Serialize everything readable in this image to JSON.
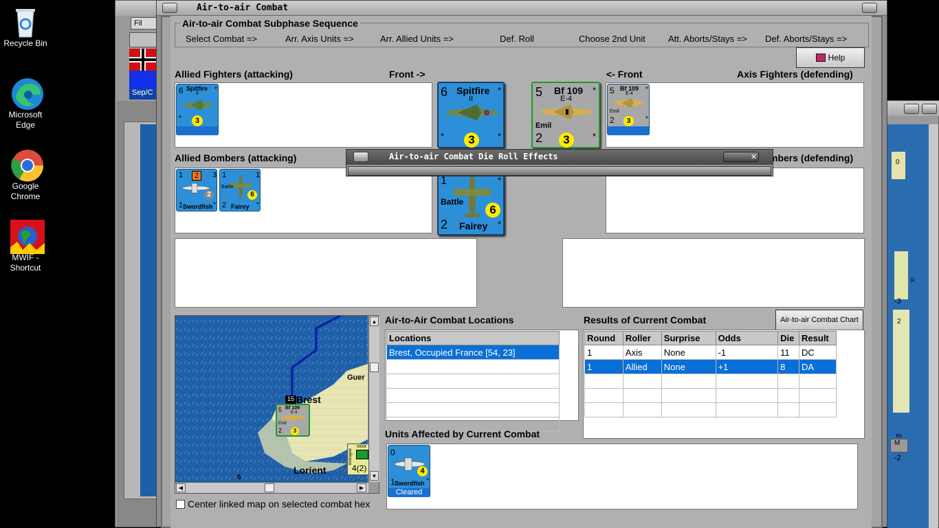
{
  "desktop": {
    "icons": [
      {
        "label": "Recycle Bin",
        "icon": "recycle-bin-icon"
      },
      {
        "label": "Microsoft Edge",
        "icon": "edge-icon"
      },
      {
        "label": "Google Chrome",
        "icon": "chrome-icon"
      },
      {
        "label": "MWIF - Shortcut",
        "icon": "mwif-icon"
      }
    ]
  },
  "background_window": {
    "tab_label": "Fil",
    "date_label": "Sep/C"
  },
  "main_window": {
    "title": "Air-to-air Combat",
    "sequence_title": "Air-to-air Combat Subphase Sequence",
    "sequence_steps": [
      "Select Combat =>",
      "Arr. Axis Units =>",
      "Arr. Allied Units =>",
      "Def. Roll",
      "Choose 2nd Unit",
      "Att. Aborts/Stays =>",
      "Def. Aborts/Stays =>"
    ],
    "help_label": "Help",
    "allied_fighters_header": "Allied Fighters (attacking)",
    "front_right_label": "Front ->",
    "front_left_label": "<- Front",
    "axis_fighters_header": "Axis Fighters (defending)",
    "allied_bombers_header": "Allied Bombers (attacking)",
    "axis_bombers_header_visible": "mbers (defending)",
    "locations_header": "Air-to-Air Combat Locations",
    "results_header": "Results of Current Combat",
    "chart_button_label": "Air-to-air Combat Chart",
    "affected_header": "Units Affected by Current Combat",
    "center_checkbox_label": "Center linked map on selected combat hex"
  },
  "die_roll_window": {
    "title": "Air-to-air Combat Die Roll Effects"
  },
  "counters": {
    "spitfire_small": {
      "top_left": "6",
      "name": "Spitfire",
      "sub": "II",
      "circle": "3",
      "stars": "*"
    },
    "spitfire_large": {
      "top_left": "6",
      "name": "Spitfire",
      "sub": "II",
      "circle": "3",
      "stars": "*"
    },
    "bf109_large": {
      "top_left": "5",
      "name": "Bf 109",
      "sub": "E-4",
      "nick": "Emil",
      "bottom_left": "2",
      "circle": "3",
      "stars": "*"
    },
    "bf109_small": {
      "top_left": "5",
      "name": "Bf 109",
      "sub": "E-4",
      "nick": "Emil",
      "bottom_left": "2",
      "circle": "3",
      "stars": "*"
    },
    "swordfish_small": {
      "top_left": "1",
      "badge": "2",
      "top_right": "3",
      "circle": "2",
      "bottom_left": "1",
      "name": "Swordfish",
      "stars": "*"
    },
    "fairey_small": {
      "top_left": "1",
      "top_right": "1",
      "nick": "Battle",
      "circle": "6",
      "bottom_left": "2",
      "name": "Fairey",
      "stars": "*"
    },
    "fairey_large": {
      "top_left": "1",
      "nick": "Battle",
      "circle": "6",
      "bottom_left": "2",
      "name": "Fairey",
      "stars": "*"
    },
    "swordfish_affected": {
      "top_left": "0",
      "circle": "4",
      "bottom_left": "1",
      "name": "Swordfish",
      "stars": "*",
      "status": "Cleared"
    }
  },
  "map": {
    "labels": [
      "Guer",
      "Brest",
      "Lorient"
    ],
    "stack_number": "15",
    "hex_value": "5",
    "corps_label": "4(2)",
    "corps_unit": "Bretagne",
    "corps_size": "xxxx",
    "bf109_top_left": "5",
    "bf109_name": "Bf 109",
    "bf109_sub": "E-4",
    "bf109_nick": "Emil",
    "bf109_bottom_left": "2",
    "bf109_circle": "3"
  },
  "locations_table": {
    "column": "Locations",
    "rows": [
      "Brest, Occupied France [54, 23]",
      "",
      "",
      "",
      "",
      ""
    ]
  },
  "results_table": {
    "columns": [
      "Round",
      "Roller",
      "Surprise",
      "Odds",
      "Die",
      "Result"
    ],
    "rows": [
      [
        "1",
        "Axis",
        "None",
        "-1",
        "11",
        "DC"
      ],
      [
        "1",
        "Allied",
        "None",
        "+1",
        "8",
        "DA"
      ],
      [
        "",
        "",
        "",
        "",
        "",
        ""
      ],
      [
        "",
        "",
        "",
        "",
        "",
        ""
      ],
      [
        "",
        "",
        "",
        "",
        "",
        ""
      ]
    ]
  },
  "right_edge_map": {
    "labels": [
      "0",
      "-3",
      "2",
      "R",
      "xx",
      "M",
      "-2"
    ]
  },
  "colors": {
    "allied_counter": "#2d8fd8",
    "axis_counter": "#a8a8a8",
    "selection": "#0a6fd6",
    "circle": "#ffeb00",
    "sea": "#1f5fa8"
  }
}
